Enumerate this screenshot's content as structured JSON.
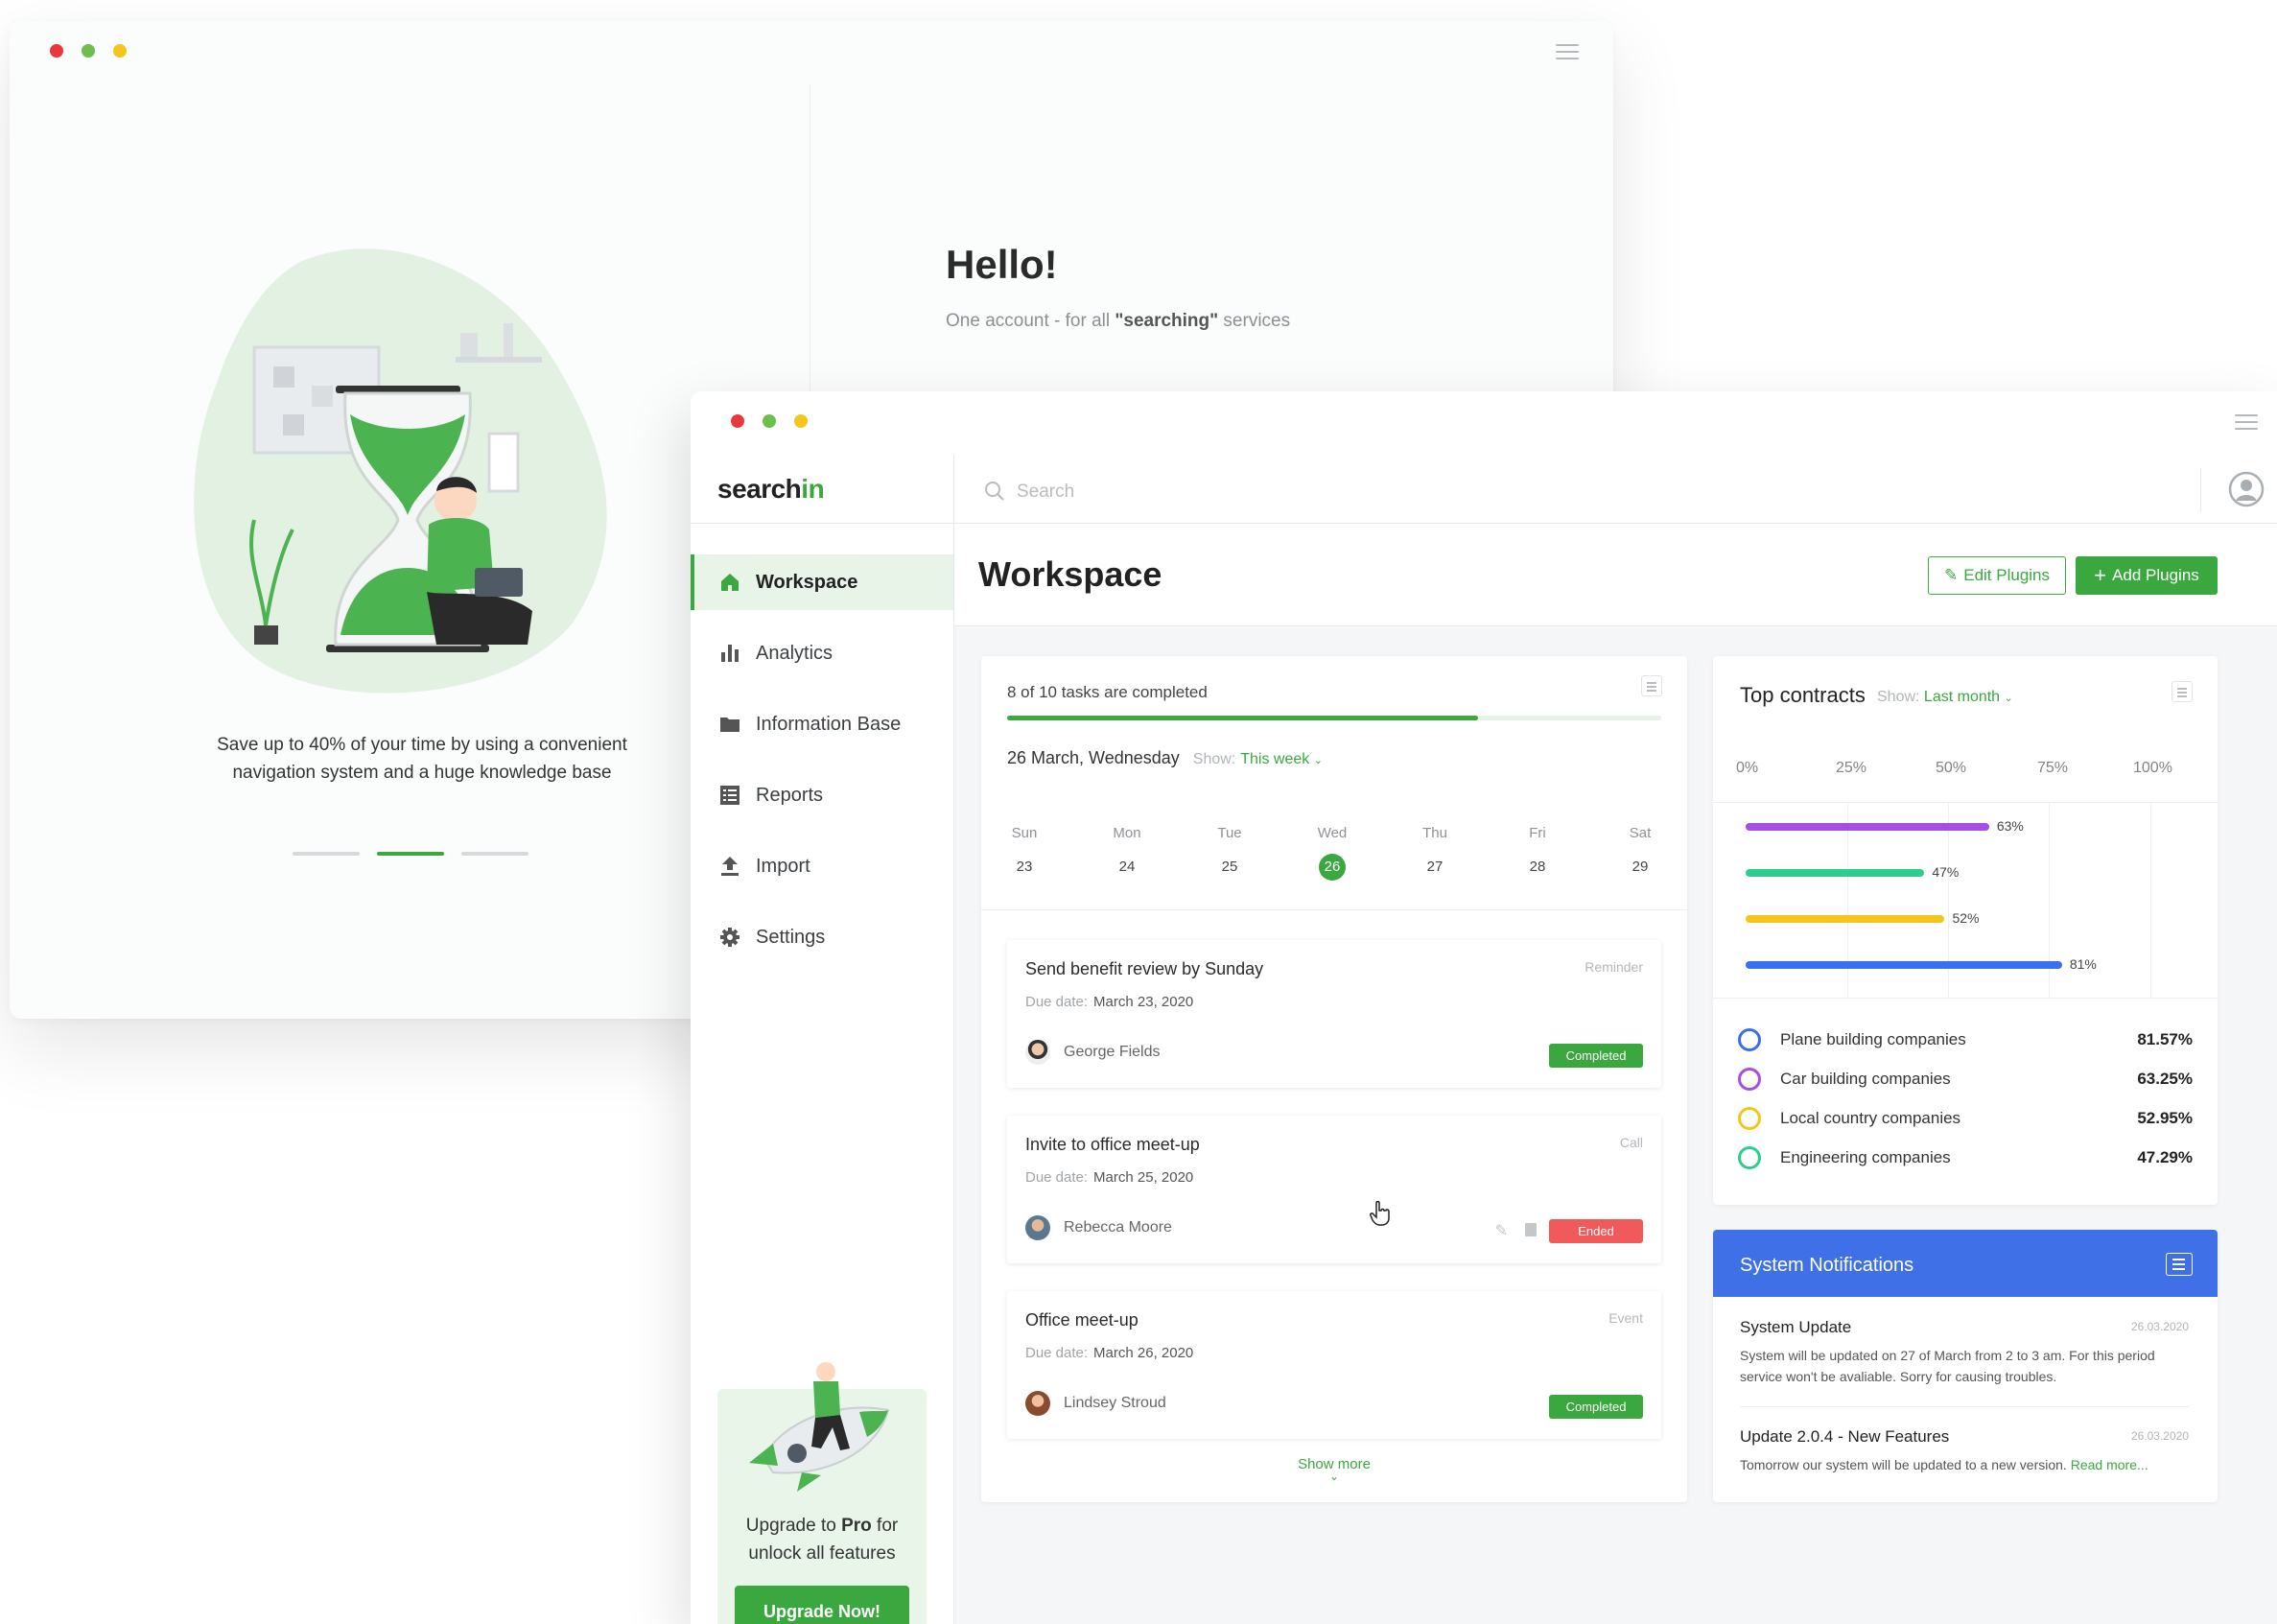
{
  "colors": {
    "accent": "#3aa83f",
    "danger": "#f05a5a",
    "notification_blue": "#4070e8",
    "dot_red": "#e8393a",
    "dot_green": "#6cbf4a",
    "dot_yellow": "#f4c51d"
  },
  "onboarding": {
    "hello_title": "Hello!",
    "hello_sub_prefix": "One account - for all ",
    "hello_sub_bold": "\"searching\"",
    "hello_sub_suffix": " services",
    "promo_line1": "Save up to 40% of your time by using a convenient",
    "promo_line2": "navigation system and a huge knowledge base",
    "pager_active_index": 1
  },
  "app": {
    "logo_prefix": "search",
    "logo_suffix": "in",
    "search_placeholder": "Search",
    "nav": [
      {
        "label": "Workspace",
        "icon": "home-icon",
        "active": true
      },
      {
        "label": "Analytics",
        "icon": "bar-chart-icon",
        "active": false
      },
      {
        "label": "Information Base",
        "icon": "folder-icon",
        "active": false
      },
      {
        "label": "Reports",
        "icon": "list-icon",
        "active": false
      },
      {
        "label": "Import",
        "icon": "upload-icon",
        "active": false
      },
      {
        "label": "Settings",
        "icon": "gear-icon",
        "active": false
      }
    ],
    "upgrade": {
      "prefix": "Upgrade to ",
      "bold": "Pro",
      "suffix": " for",
      "line2": "unlock all features",
      "button": "Upgrade Now!"
    }
  },
  "workspace": {
    "title": "Workspace",
    "edit_plugins": "Edit Plugins",
    "add_plugins": "Add Plugins"
  },
  "tasks": {
    "progress_label": "8 of 10 tasks are completed",
    "progress_fraction": 0.8,
    "date": "26 March, Wednesday",
    "show_label": "Show:",
    "show_value": "This week",
    "days": [
      {
        "name": "Sun",
        "num": "23"
      },
      {
        "name": "Mon",
        "num": "24"
      },
      {
        "name": "Tue",
        "num": "25"
      },
      {
        "name": "Wed",
        "num": "26",
        "selected": true
      },
      {
        "name": "Thu",
        "num": "27"
      },
      {
        "name": "Fri",
        "num": "28"
      },
      {
        "name": "Sat",
        "num": "29"
      }
    ],
    "due_label": "Due date:",
    "items": [
      {
        "title": "Send benefit review by Sunday",
        "type": "Reminder",
        "due": "March 23, 2020",
        "person": "George Fields",
        "status": "Completed"
      },
      {
        "title": "Invite to office meet-up",
        "type": "Call",
        "due": "March 25, 2020",
        "person": "Rebecca Moore",
        "status": "Ended"
      },
      {
        "title": "Office meet-up",
        "type": "Event",
        "due": "March 26, 2020",
        "person": "Lindsey Stroud",
        "status": "Completed"
      }
    ],
    "show_more": "Show more"
  },
  "contracts": {
    "title": "Top contracts",
    "show_label": "Show:",
    "show_value": "Last month",
    "axis": [
      "0%",
      "25%",
      "50%",
      "75%",
      "100%"
    ],
    "bars": [
      {
        "value": 63,
        "label": "63%",
        "color": "#a64ee0"
      },
      {
        "value": 47,
        "label": "47%",
        "color": "#2ecc8f"
      },
      {
        "value": 52,
        "label": "52%",
        "color": "#f4c51d"
      },
      {
        "value": 81,
        "label": "81%",
        "color": "#3a6ff0"
      }
    ],
    "legend": [
      {
        "name": "Plane building companies",
        "value": "81.57%",
        "color": "#3a6ff0"
      },
      {
        "name": "Car building companies",
        "value": "63.25%",
        "color": "#a64ee0"
      },
      {
        "name": "Local country companies",
        "value": "52.95%",
        "color": "#f4c51d"
      },
      {
        "name": "Engineering companies",
        "value": "47.29%",
        "color": "#2ecc8f"
      }
    ]
  },
  "notifications": {
    "title": "System Notifications",
    "items": [
      {
        "title": "System Update",
        "date": "26.03.2020",
        "body": "System will be updated on 27 of March from 2 to 3 am. For this period service won't be avaliable. Sorry for causing troubles."
      },
      {
        "title": "Update 2.0.4 - New Features",
        "date": "26.03.2020",
        "body": "Tomorrow our system will be updated to a new version. ",
        "link": "Read more..."
      }
    ]
  }
}
